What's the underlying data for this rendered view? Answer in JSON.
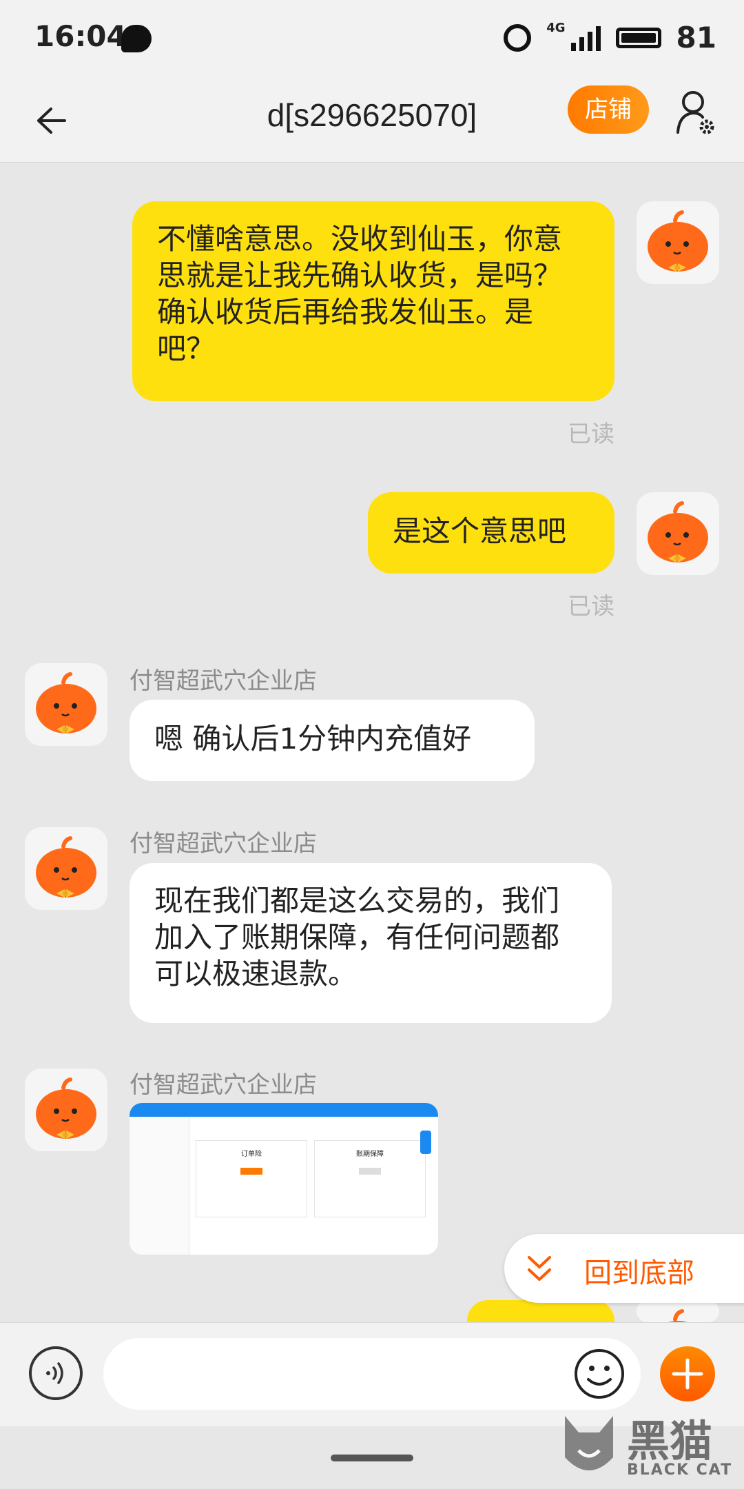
{
  "status": {
    "time": "16:04",
    "network": "4G",
    "battery": "81"
  },
  "header": {
    "title": "d[s296625070]",
    "store_button": "店铺"
  },
  "messages": [
    {
      "text": "不懂啥意思。没收到仙玉，你意思就是让我先确认收货，是吗？确认收货后再给我发仙玉。是吧？",
      "read": "已读"
    },
    {
      "text": "是这个意思吧",
      "read": "已读"
    },
    {
      "sender": "付智超武穴企业店",
      "text": "嗯 确认后1分钟内充值好"
    },
    {
      "sender": "付智超武穴企业店",
      "text": "现在我们都是这么交易的，我们加入了账期保障，有任何问题都可以极速退款。"
    },
    {
      "sender": "付智超武穴企业店"
    }
  ],
  "screenshot": {
    "left_label": "订单险",
    "right_label": "账期保障"
  },
  "scroll_to_bottom": "回到底部",
  "watermark": {
    "cn": "黑猫",
    "en": "BLACK CAT"
  }
}
